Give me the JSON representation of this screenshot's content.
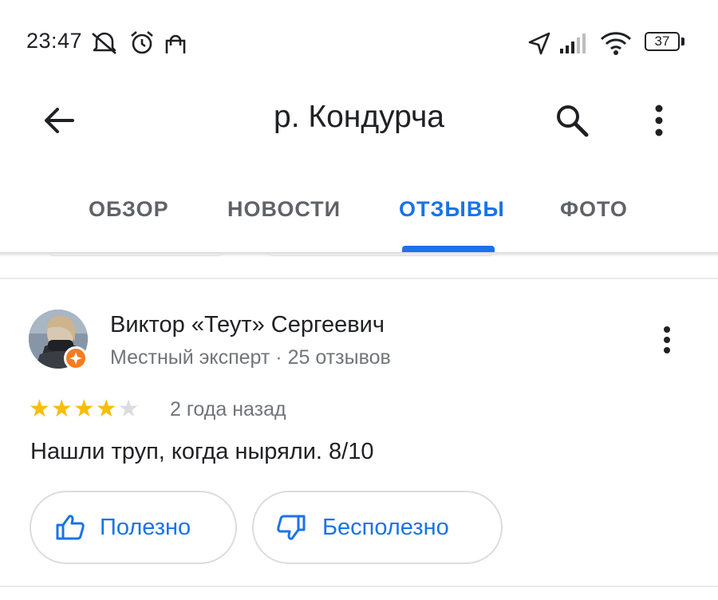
{
  "status_bar": {
    "time": "23:47",
    "icons": [
      "bell-off-icon",
      "alarm-icon",
      "bag-icon",
      "location-arrow-icon",
      "signal-icon",
      "wifi-icon",
      "battery-icon"
    ],
    "battery_level": "37"
  },
  "app_bar": {
    "title": "р. Кондурча",
    "back_icon": "arrow-left-icon",
    "search_icon": "search-icon",
    "more_icon": "more-vert-icon"
  },
  "tabs": [
    {
      "label": "ОБЗОР",
      "active": false
    },
    {
      "label": "НОВОСТИ",
      "active": false
    },
    {
      "label": "ОТЗЫВЫ",
      "active": true
    },
    {
      "label": "ФОТО",
      "active": false
    }
  ],
  "review": {
    "author": "Виктор «Теут» Сергеевич",
    "meta": "Местный эксперт · 25 отзывов",
    "rating": 4,
    "rating_max": 5,
    "date": "2 года назад",
    "text": "Нашли труп, когда ныряли. 8/10",
    "helpful_label": "Полезно",
    "not_helpful_label": "Бесполезно"
  },
  "colors": {
    "accent": "#1a73e8",
    "star": "#fbbc04",
    "star_empty": "#dadce0",
    "badge": "#f57c20",
    "text_secondary": "#70757a"
  }
}
